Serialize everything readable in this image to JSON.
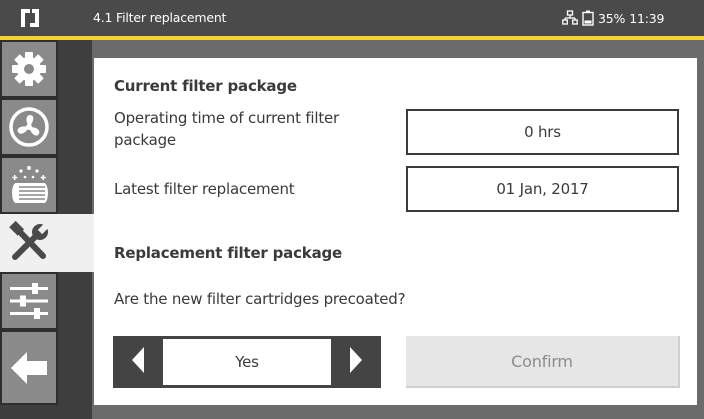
{
  "header": {
    "title": "4.1 Filter replacement",
    "battery": "35%",
    "time": "11:39",
    "icons": {
      "logo": "app-logo-icon",
      "network": "network-icon",
      "battery": "battery-icon"
    }
  },
  "sidebar": {
    "items": [
      {
        "name": "settings",
        "icon": "gear-icon",
        "active": false
      },
      {
        "name": "fan",
        "icon": "fan-icon",
        "active": false
      },
      {
        "name": "filter",
        "icon": "filter-cartridge-icon",
        "active": false
      },
      {
        "name": "maintenance",
        "icon": "tools-icon",
        "active": true
      },
      {
        "name": "adjustments",
        "icon": "sliders-icon",
        "active": false
      },
      {
        "name": "back",
        "icon": "back-arrow-icon",
        "active": false
      }
    ]
  },
  "main": {
    "current_section_title": "Current filter package",
    "operating_time_label": "Operating time of current filter package",
    "operating_time_value": "0 hrs",
    "latest_replacement_label": "Latest filter replacement",
    "latest_replacement_value": "01 Jan, 2017",
    "replacement_section_title": "Replacement filter package",
    "question": "Are the new filter cartridges precoated?",
    "selector_value": "Yes",
    "confirm_label": "Confirm"
  },
  "colors": {
    "accent": "#f2d232",
    "topbar": "#4a4a4a",
    "sidebar_tab": "#8a8a8a",
    "active_tab": "#f0f0f0",
    "selector_bg": "#444444",
    "confirm_bg": "#e6e6e6"
  }
}
